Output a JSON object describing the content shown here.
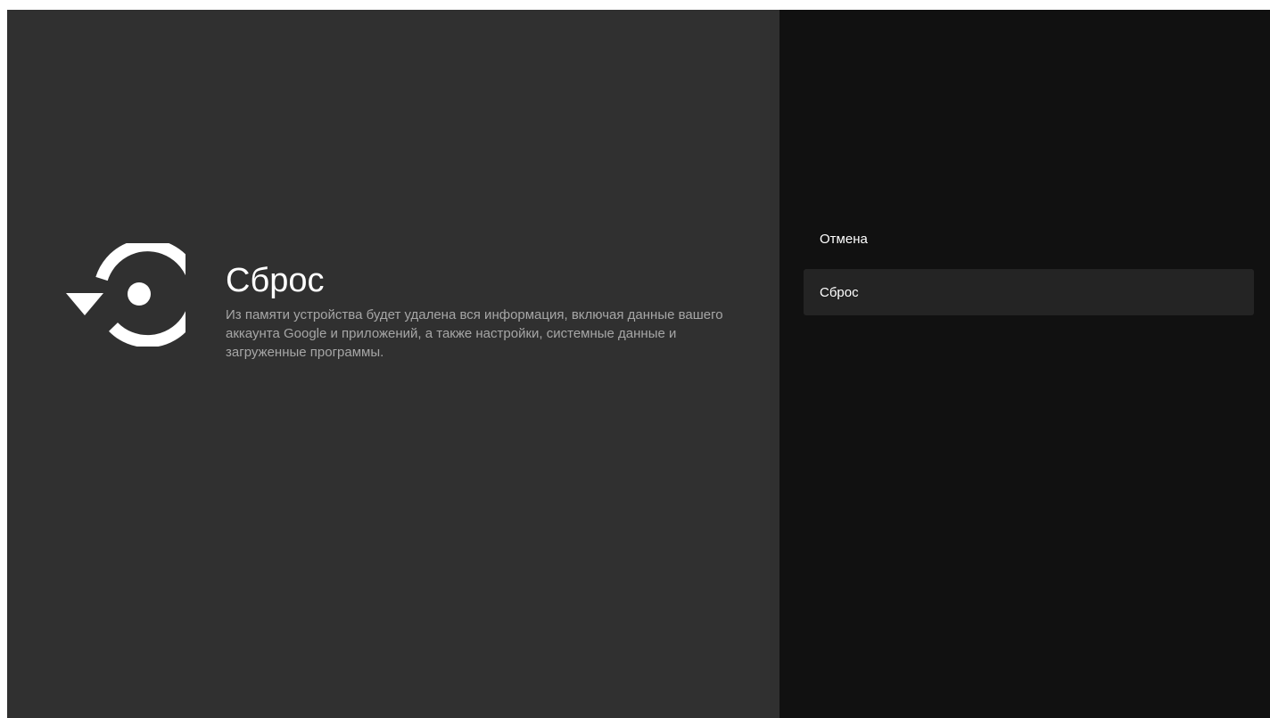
{
  "dialog": {
    "icon": "reset-icon",
    "title": "Сброс",
    "description": "Из памяти устройства будет удалена вся информация, включая данные вашего аккаунта Google и приложений, а также настройки, системные данные и загруженные программы."
  },
  "actions": [
    {
      "label": "Отмена",
      "focused": false
    },
    {
      "label": "Сброс",
      "focused": true
    }
  ],
  "colors": {
    "content_bg": "#303030",
    "actions_bg": "#111111",
    "focused_item_bg": "#242424",
    "title_text": "#ffffff",
    "description_text": "#a6a6a6"
  }
}
